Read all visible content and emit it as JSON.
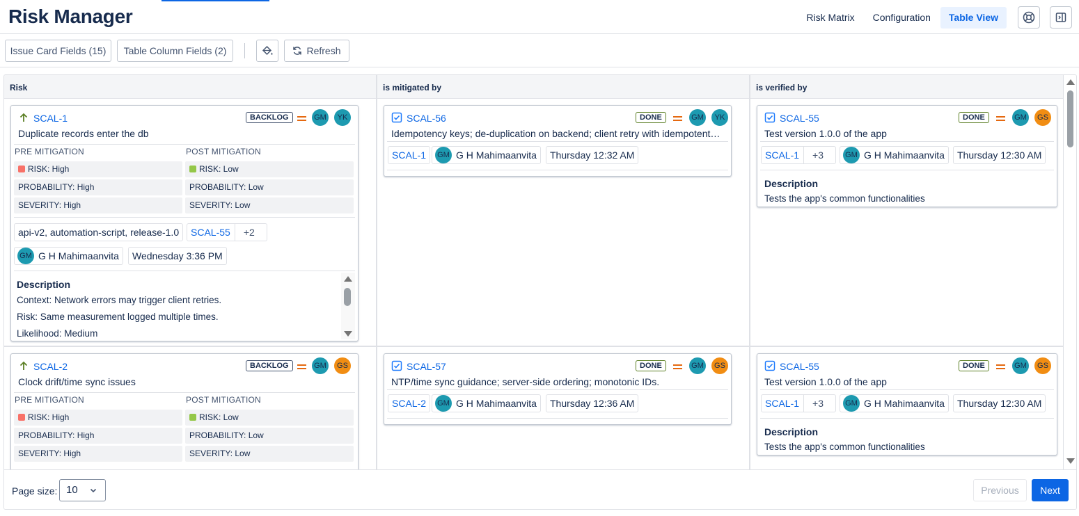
{
  "header": {
    "title": "Risk Manager",
    "nav": [
      "Risk Matrix",
      "Configuration",
      "Table View"
    ],
    "active_nav": "Table View",
    "help_icon": "lifebuoy-icon",
    "panel_icon": "sidebar-panel-icon"
  },
  "toolbar": {
    "issue_card_fields": "Issue Card Fields (15)",
    "table_column_fields": "Table Column Fields (2)",
    "paint_icon": "paint-bucket-icon",
    "refresh_label": "Refresh",
    "refresh_icon": "refresh-icon"
  },
  "table": {
    "columns": [
      "Risk",
      "is mitigated by",
      "is verified by"
    ],
    "rows": [
      {
        "risk": {
          "key": "SCAL-1",
          "status": "BACKLOG",
          "summary": "Duplicate records enter the db",
          "avatars": [
            "GM",
            "YK"
          ],
          "pre_label": "PRE MITIGATION",
          "post_label": "POST MITIGATION",
          "pre": [
            "RISK: High",
            "PROBABILITY: High",
            "SEVERITY: High"
          ],
          "post": [
            "RISK: Low",
            "PROBABILITY: Low",
            "SEVERITY: Low"
          ],
          "labels": "api-v2, automation-script, release-1.0",
          "linked_key": "SCAL-55",
          "linked_more": "+2",
          "assignee_initials": "GM",
          "assignee": "G H Mahimaanvita",
          "updated": "Wednesday 3:36 PM",
          "desc_title": "Description",
          "desc_lines": [
            "Context: Network errors may trigger client retries.",
            "Risk: Same measurement logged multiple times.",
            "Likelihood: Medium"
          ]
        },
        "mitigated": {
          "key": "SCAL-56",
          "status": "DONE",
          "summary": "Idempotency keys; de-duplication on backend; client retry with idempotent…",
          "avatars": [
            "GM",
            "YK"
          ],
          "linked_key": "SCAL-1",
          "assignee_initials": "GM",
          "assignee": "G H Mahimaanvita",
          "updated": "Thursday 12:32 AM"
        },
        "verified": {
          "key": "SCAL-55",
          "status": "DONE",
          "summary": "Test version 1.0.0 of the app",
          "avatars": [
            "GM",
            "GS"
          ],
          "linked_key": "SCAL-1",
          "linked_more": "+3",
          "assignee_initials": "GM",
          "assignee": "G H Mahimaanvita",
          "updated": "Thursday 12:30 AM",
          "desc_title": "Description",
          "desc_text": "Tests the app's common functionalities"
        }
      },
      {
        "risk": {
          "key": "SCAL-2",
          "status": "BACKLOG",
          "summary": "Clock drift/time sync issues",
          "avatars": [
            "GM",
            "GS"
          ],
          "pre_label": "PRE MITIGATION",
          "post_label": "POST MITIGATION",
          "pre": [
            "RISK: High",
            "PROBABILITY: High",
            "SEVERITY: High"
          ],
          "post": [
            "RISK: Low",
            "PROBABILITY: Low",
            "SEVERITY: Low"
          ]
        },
        "mitigated": {
          "key": "SCAL-57",
          "status": "DONE",
          "summary": "NTP/time sync guidance; server-side ordering; monotonic IDs.",
          "avatars": [
            "GM",
            "GS"
          ],
          "linked_key": "SCAL-2",
          "assignee_initials": "GM",
          "assignee": "G H Mahimaanvita",
          "updated": "Thursday 12:36 AM"
        },
        "verified": {
          "key": "SCAL-55",
          "status": "DONE",
          "summary": "Test version 1.0.0 of the app",
          "avatars": [
            "GM",
            "GS"
          ],
          "linked_key": "SCAL-1",
          "linked_more": "+3",
          "assignee_initials": "GM",
          "assignee": "G H Mahimaanvita",
          "updated": "Thursday 12:30 AM",
          "desc_title": "Description",
          "desc_text": "Tests the app's common functionalities"
        }
      }
    ]
  },
  "pagination": {
    "page_size_label": "Page size:",
    "page_size": "10",
    "previous": "Previous",
    "next": "Next"
  },
  "colors": {
    "accent": "#0c66e4",
    "high": "#f87168",
    "low": "#94c748",
    "priority_medium": "#e56910",
    "avatar_teal": "#1d9ab0",
    "avatar_orange": "#f18d13"
  }
}
